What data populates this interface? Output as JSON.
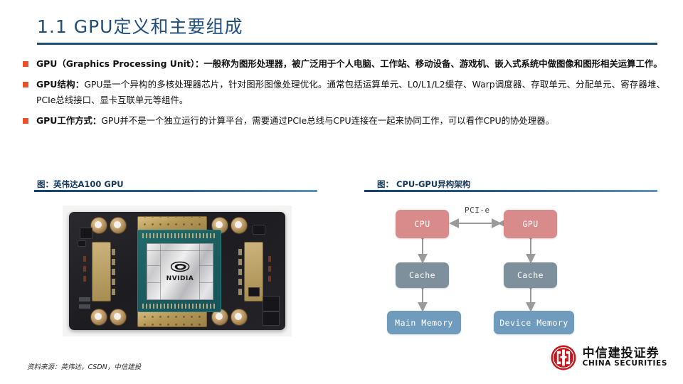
{
  "slide": {
    "title": "1.1 GPU定义和主要组成",
    "title_color": "#1f4e79",
    "bullet_marker_color": "#e8502a"
  },
  "bullets": [
    {
      "id": "gpu-definition",
      "lead": "GPU（Graphics Processing Unit）：",
      "body": "一般称为图形处理器，被广泛用于个人电脑、工作站、移动设备、游戏机、嵌入式系统中做图像和图形相关运算工作。"
    },
    {
      "id": "gpu-structure",
      "lead": "GPU结构：",
      "body": "GPU是一个异构的多核处理器芯片，针对图形图像处理优化。通常包括运算单元、L0/L1/L2缓存、Warp调度器、存取单元、分配单元、寄存器堆、PCIe总线接口、显卡互联单元等组件。"
    },
    {
      "id": "gpu-working-mode",
      "lead": "GPU工作方式：",
      "body": "GPU并不是一个独立运行的计算平台，需要通过PCIe总线与CPU连接在一起来协同工作，可以看作CPU的协处理器。"
    }
  ],
  "figures": {
    "left": {
      "caption": "图：英伟达A100 GPU",
      "photo_alt": "NVIDIA A100 GPU module",
      "die_logo_text": "NVIDIA"
    },
    "right": {
      "caption": "图： CPU-GPU异构架构",
      "interconnect_label": "PCI-e",
      "nodes": {
        "cpu": "CPU",
        "gpu": "GPU",
        "cpu_cache": "Cache",
        "gpu_cache": "Cache",
        "main_memory": "Main Memory",
        "device_memory": "Device Memory"
      },
      "colors": {
        "processor": "#d98b8b",
        "cache": "#7e909b",
        "memory": "#6f9cbd",
        "arrow": "#9a9a9a"
      }
    }
  },
  "footer": {
    "source": "资料来源：英伟达，CSDN，中信建投",
    "brand_cn": "中信建投证券",
    "brand_en": "CHINA SECURITIES",
    "brand_color": "#c8161d"
  }
}
